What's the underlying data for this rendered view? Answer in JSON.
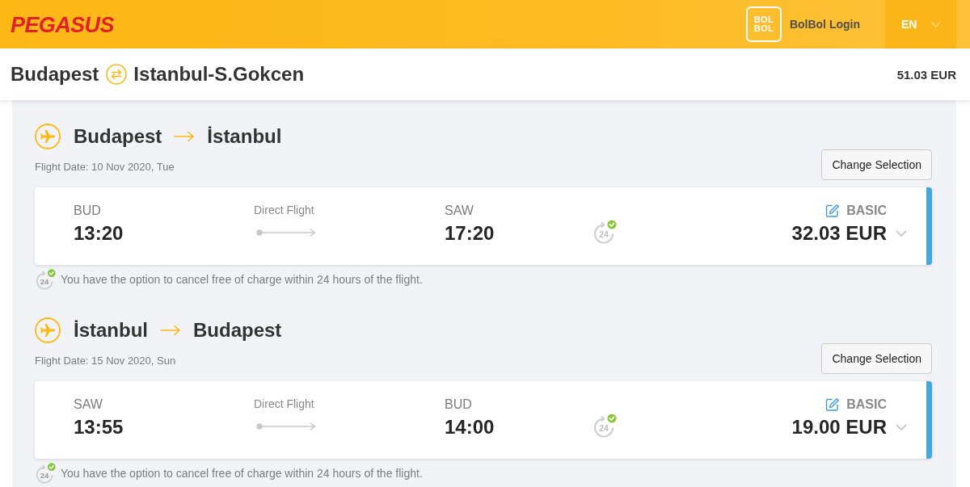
{
  "header": {
    "logo": "PEGASUS",
    "program_logo": [
      "BOL",
      "BOL"
    ],
    "login": "BolBol Login",
    "language": "EN"
  },
  "summary": {
    "origin": "Budapest",
    "destination": "Istanbul-S.Gokcen",
    "total": "51.03 EUR"
  },
  "legs": [
    {
      "origin": "Budapest",
      "destination": "İstanbul",
      "date": "Flight Date: 10 Nov 2020, Tue",
      "action": "Change Selection",
      "flight": {
        "departure_code": "BUD",
        "departure_time": "13:20",
        "type": "Direct Flight",
        "arrival_code": "SAW",
        "arrival_time": "17:20",
        "flex_badge": "24",
        "fare": "BASIC",
        "price": "32.03 EUR",
        "expanded": false
      },
      "note": {
        "badge": "24",
        "text": "You have the option to cancel free of charge within 24 hours of the flight."
      }
    },
    {
      "origin": "İstanbul",
      "destination": "Budapest",
      "date": "Flight Date: 15 Nov 2020, Sun",
      "action": "Change Selection",
      "flight": {
        "departure_code": "SAW",
        "departure_time": "13:55",
        "type": "Direct Flight",
        "arrival_code": "BUD",
        "arrival_time": "14:00",
        "flex_badge": "24",
        "fare": "BASIC",
        "price": "19.00 EUR",
        "expanded": false
      },
      "note": {
        "badge": "24",
        "text": "You have the option to cancel free of charge within 24 hours of the flight."
      }
    }
  ]
}
